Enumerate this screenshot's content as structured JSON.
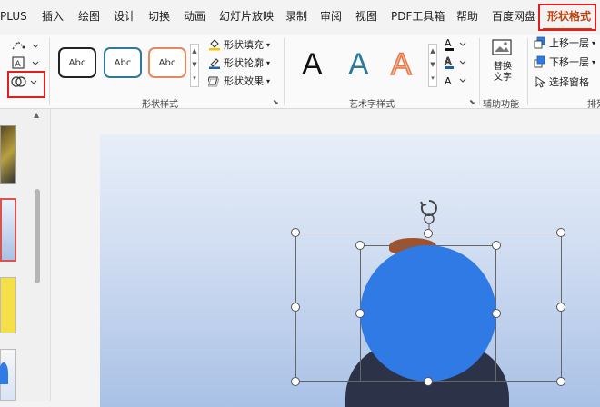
{
  "tabs": [
    "PLUS",
    "插入",
    "绘图",
    "设计",
    "切换",
    "动画",
    "幻灯片放映",
    "录制",
    "审阅",
    "视图",
    "PDF工具箱",
    "帮助",
    "百度网盘",
    "形状格式"
  ],
  "active_tab": "形状格式",
  "shape_styles": {
    "label": "形状样式",
    "presets": [
      "Abc",
      "Abc",
      "Abc"
    ],
    "fill": "形状填充",
    "outline": "形状轮廓",
    "effects": "形状效果"
  },
  "wordart": {
    "label": "艺术字样式",
    "letters": [
      "A",
      "A",
      "A"
    ]
  },
  "accessibility": {
    "label": "辅助功能",
    "alt_text": "替换\n文字"
  },
  "arrange": {
    "label": "排列",
    "bring_forward": "上移一层",
    "send_backward": "下移一层",
    "selection_pane": "选择窗格"
  },
  "colors": {
    "accent_red": "#e02020",
    "active_tab": "#c2410c",
    "circle_fill": "#2f7ae5"
  }
}
